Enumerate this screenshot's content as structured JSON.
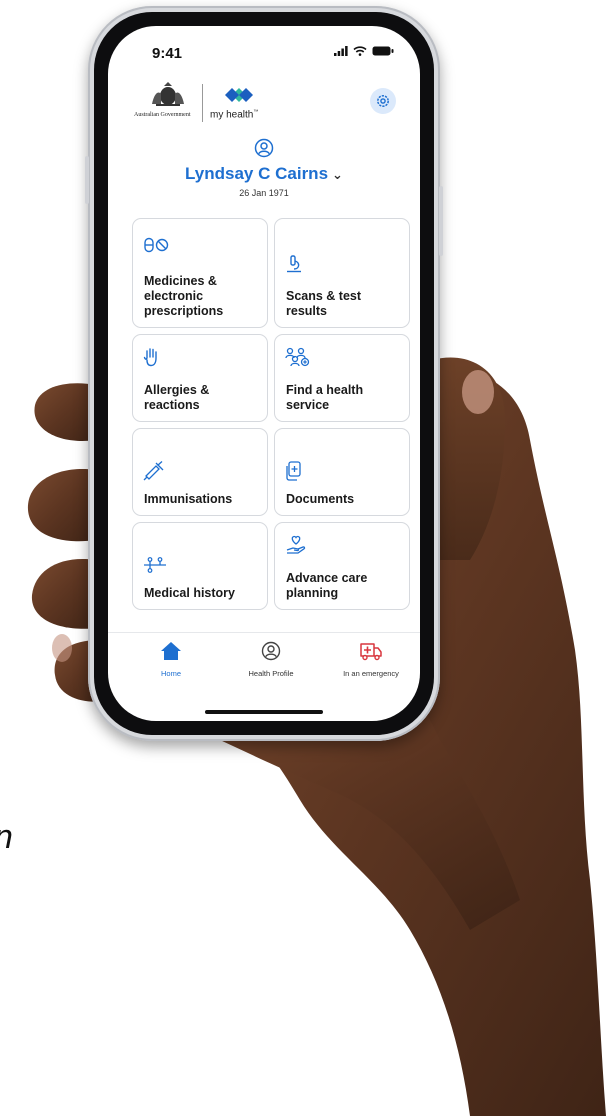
{
  "status_bar": {
    "time": "9:41"
  },
  "header": {
    "government_label": "Australian Government",
    "app_name": "my health",
    "app_name_tm": "™"
  },
  "profile": {
    "name": "Lyndsay C Cairns",
    "dob": "26 Jan 1971"
  },
  "tiles": [
    {
      "label_lines": [
        "Medicines &",
        "electronic",
        "prescriptions"
      ],
      "icon": "pills-icon"
    },
    {
      "label_lines": [
        "Scans & test",
        "results"
      ],
      "icon": "microscope-icon"
    },
    {
      "label_lines": [
        "Allergies &",
        "reactions"
      ],
      "icon": "hand-icon"
    },
    {
      "label_lines": [
        "Find a health",
        "service"
      ],
      "icon": "people-search-icon"
    },
    {
      "label_lines": [
        "Immunisations"
      ],
      "icon": "syringe-icon"
    },
    {
      "label_lines": [
        "Documents"
      ],
      "icon": "document-plus-icon"
    },
    {
      "label_lines": [
        "Medical history"
      ],
      "icon": "timeline-icon"
    },
    {
      "label_lines": [
        "Advance care",
        "planning"
      ],
      "icon": "heart-hand-icon"
    }
  ],
  "nav": {
    "home": "Home",
    "health_profile": "Health Profile",
    "emergency": "In an emergency"
  },
  "background_text": "n",
  "colors": {
    "accent": "#1e6fd0",
    "emergency": "#d9363e",
    "logo_blue": "#1b5fbf",
    "logo_green": "#2fb89e"
  }
}
